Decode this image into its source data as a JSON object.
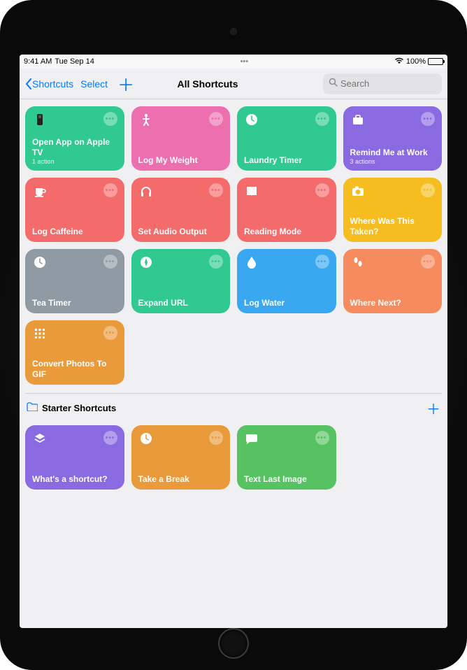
{
  "status": {
    "time": "9:41 AM",
    "date": "Tue Sep 14",
    "battery_pct": "100%"
  },
  "nav": {
    "back_label": "Shortcuts",
    "select_label": "Select",
    "title": "All Shortcuts",
    "search_placeholder": "Search"
  },
  "shortcuts": [
    {
      "title": "Open App on Apple TV",
      "sub": "1 action",
      "icon": "appletv",
      "bg": "#2fc991"
    },
    {
      "title": "Log My Weight",
      "sub": "",
      "icon": "person",
      "bg": "#ec6fb0"
    },
    {
      "title": "Laundry Timer",
      "sub": "",
      "icon": "clock",
      "bg": "#2fc991"
    },
    {
      "title": "Remind Me at Work",
      "sub": "3 actions",
      "icon": "briefcase",
      "bg": "#8a6ae0"
    },
    {
      "title": "Log Caffeine",
      "sub": "",
      "icon": "cup",
      "bg": "#f46b6b"
    },
    {
      "title": "Set Audio Output",
      "sub": "",
      "icon": "headphones",
      "bg": "#f46b6b"
    },
    {
      "title": "Reading Mode",
      "sub": "",
      "icon": "book",
      "bg": "#f46b6b"
    },
    {
      "title": "Where Was This Taken?",
      "sub": "",
      "icon": "camera",
      "bg": "#f5bd20"
    },
    {
      "title": "Tea Timer",
      "sub": "",
      "icon": "clock",
      "bg": "#8f9aa3"
    },
    {
      "title": "Expand URL",
      "sub": "",
      "icon": "compass",
      "bg": "#2fc991"
    },
    {
      "title": "Log Water",
      "sub": "",
      "icon": "drop",
      "bg": "#3aa8f0"
    },
    {
      "title": "Where Next?",
      "sub": "",
      "icon": "steps",
      "bg": "#f58b5e"
    },
    {
      "title": "Convert Photos To GIF",
      "sub": "",
      "icon": "grid",
      "bg": "#e99a3a"
    }
  ],
  "section2": {
    "title": "Starter Shortcuts",
    "items": [
      {
        "title": "What's a shortcut?",
        "sub": "",
        "icon": "layers",
        "bg": "#8a6ae0"
      },
      {
        "title": "Take a Break",
        "sub": "",
        "icon": "clock",
        "bg": "#e99a3a"
      },
      {
        "title": "Text Last Image",
        "sub": "",
        "icon": "chat",
        "bg": "#57c262"
      }
    ]
  },
  "colors": {
    "tint": "#007aff"
  }
}
